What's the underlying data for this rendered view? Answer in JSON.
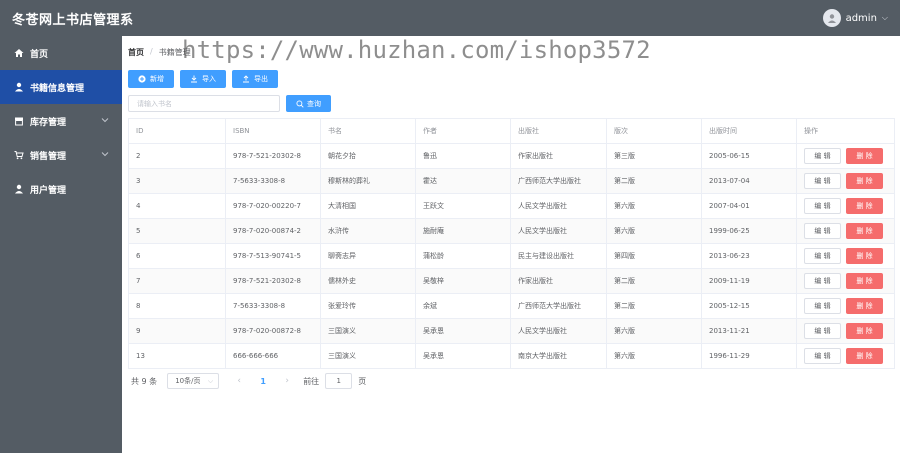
{
  "app": {
    "title": "冬苍网上书店管理系"
  },
  "user": {
    "name": "admin"
  },
  "watermark": "https://www.huzhan.com/ishop3572",
  "sidebar": {
    "items": [
      {
        "label": "首页"
      },
      {
        "label": "书籍信息管理"
      },
      {
        "label": "库存管理"
      },
      {
        "label": "销售管理"
      },
      {
        "label": "用户管理"
      }
    ]
  },
  "breadcrumb": {
    "home": "首页",
    "sep": "/",
    "current": "书籍管理"
  },
  "toolbar": {
    "add": "新增",
    "import": "导入",
    "export": "导出"
  },
  "search": {
    "placeholder": "请输入书名",
    "button": "查询"
  },
  "table": {
    "headers": [
      "ID",
      "ISBN",
      "书名",
      "作者",
      "出版社",
      "版次",
      "出版时间",
      "操作"
    ],
    "edit_label": "编 辑",
    "delete_label": "删 除",
    "rows": [
      [
        "2",
        "978-7-521-20302-8",
        "朝花夕拾",
        "鲁迅",
        "作家出版社",
        "第三版",
        "2005-06-15"
      ],
      [
        "3",
        "7-5633-3308-8",
        "穆斯林的葬礼",
        "霍达",
        "广西师范大学出版社",
        "第二版",
        "2013-07-04"
      ],
      [
        "4",
        "978-7-020-00220-7",
        "大清相国",
        "王跃文",
        "人民文学出版社",
        "第六版",
        "2007-04-01"
      ],
      [
        "5",
        "978-7-020-00874-2",
        "水浒传",
        "施耐庵",
        "人民文学出版社",
        "第六版",
        "1999-06-25"
      ],
      [
        "6",
        "978-7-513-90741-5",
        "聊斋志异",
        "蒲松龄",
        "民主与建设出版社",
        "第四版",
        "2013-06-23"
      ],
      [
        "7",
        "978-7-521-20302-8",
        "儒林外史",
        "吴敬梓",
        "作家出版社",
        "第二版",
        "2009-11-19"
      ],
      [
        "8",
        "7-5633-3308-8",
        "张爱玲传",
        "余斌",
        "广西师范大学出版社",
        "第二版",
        "2005-12-15"
      ],
      [
        "9",
        "978-7-020-00872-8",
        "三国演义",
        "吴承恩",
        "人民文学出版社",
        "第六版",
        "2013-11-21"
      ],
      [
        "13",
        "666-666-666",
        "三国演义",
        "吴承恩",
        "南京大学出版社",
        "第六版",
        "1996-11-29"
      ]
    ]
  },
  "pagination": {
    "total_text": "共 9 条",
    "page_size": "10条/页",
    "current_page": "1",
    "goto_label": "前往",
    "goto_value": "1",
    "page_suffix": "页"
  }
}
